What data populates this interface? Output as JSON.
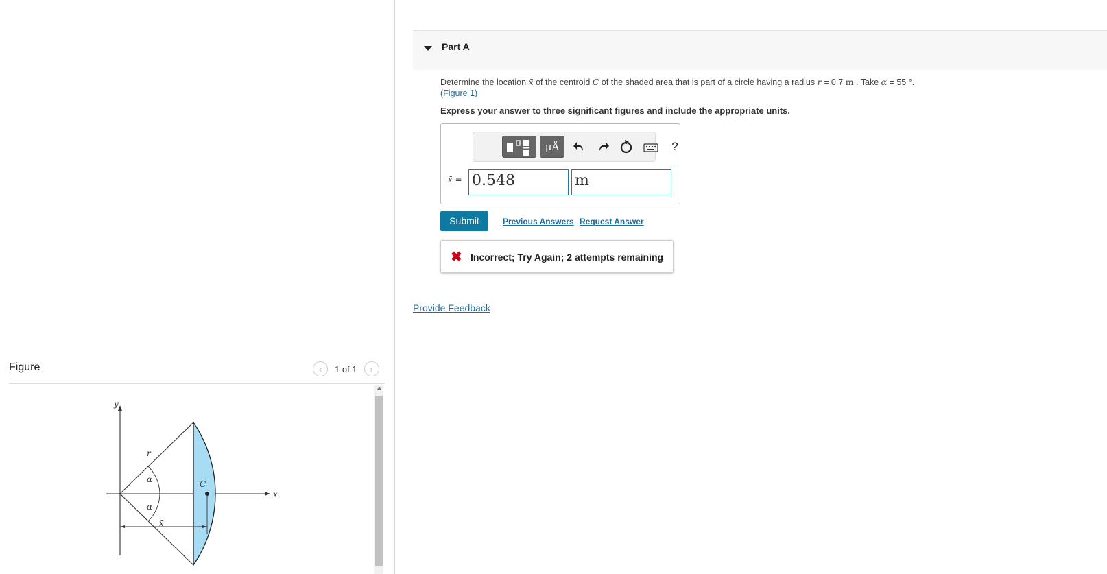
{
  "part": {
    "title": "Part A"
  },
  "question": {
    "text_1": "Determine the location ",
    "xbar_symbol": "x̄",
    "text_2": " of the centroid ",
    "centroid_symbol": "C",
    "text_3": " of the shaded area that is part of a circle having a radius ",
    "r_symbol": "r",
    "text_4": " = 0.7 ",
    "unit_m": "m",
    "text_5": " . Take ",
    "alpha_symbol": "α",
    "text_6": " = 55 °.",
    "figure_link": "(Figure 1)",
    "instruction": "Express your answer to three significant figures and include the appropriate units."
  },
  "toolbar": {
    "units_label": "μÅ",
    "undo_icon": "undo-icon",
    "redo_icon": "redo-icon",
    "reset_icon": "reset-icon",
    "keyboard_icon": "keyboard-icon",
    "help_label": "?"
  },
  "answer": {
    "variable_label": "x̄ =",
    "value": "0.548",
    "unit": "m"
  },
  "actions": {
    "submit": "Submit",
    "previous_answers": "Previous Answers",
    "request_answer": "Request Answer"
  },
  "feedback": {
    "icon": "incorrect-x-icon",
    "message": "Incorrect; Try Again; 2 attempts remaining",
    "color": "#d0021b"
  },
  "provide_feedback": "Provide Feedback",
  "figure": {
    "title": "Figure",
    "pager": "1 of 1",
    "labels": {
      "y": "y",
      "x": "x",
      "r": "r",
      "alpha_top": "α",
      "alpha_bottom": "α",
      "c": "C",
      "xbar": "x̄"
    },
    "shade_color": "#a8dcf5"
  }
}
